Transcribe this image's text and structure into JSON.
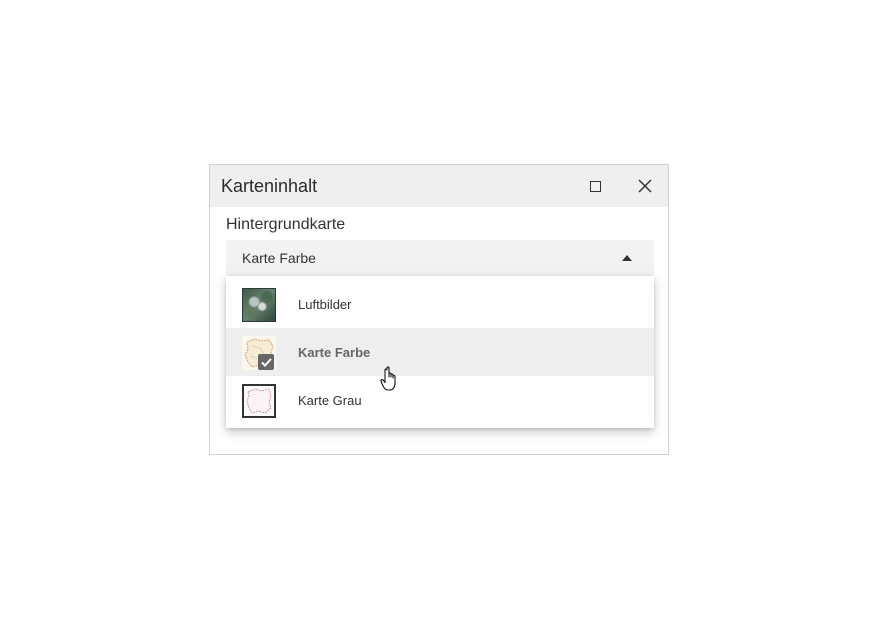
{
  "panel": {
    "title": "Karteninhalt",
    "maximize_icon": "maximize-icon",
    "close_icon": "close-icon"
  },
  "background_map": {
    "label": "Hintergrundkarte",
    "selected_value": "Karte Farbe",
    "caret_icon": "caret-up-icon",
    "options": [
      {
        "label": "Luftbilder",
        "thumbnail": "aerial-photo-thumbnail",
        "selected": false
      },
      {
        "label": "Karte Farbe",
        "thumbnail": "color-map-thumbnail",
        "selected": true
      },
      {
        "label": "Karte Grau",
        "thumbnail": "gray-map-thumbnail",
        "selected": false
      }
    ]
  },
  "colors": {
    "header_bg": "#efefef",
    "select_bg": "#f2f2f2",
    "selected_option_bg": "#eeeeee",
    "check_badge": "#666666"
  }
}
